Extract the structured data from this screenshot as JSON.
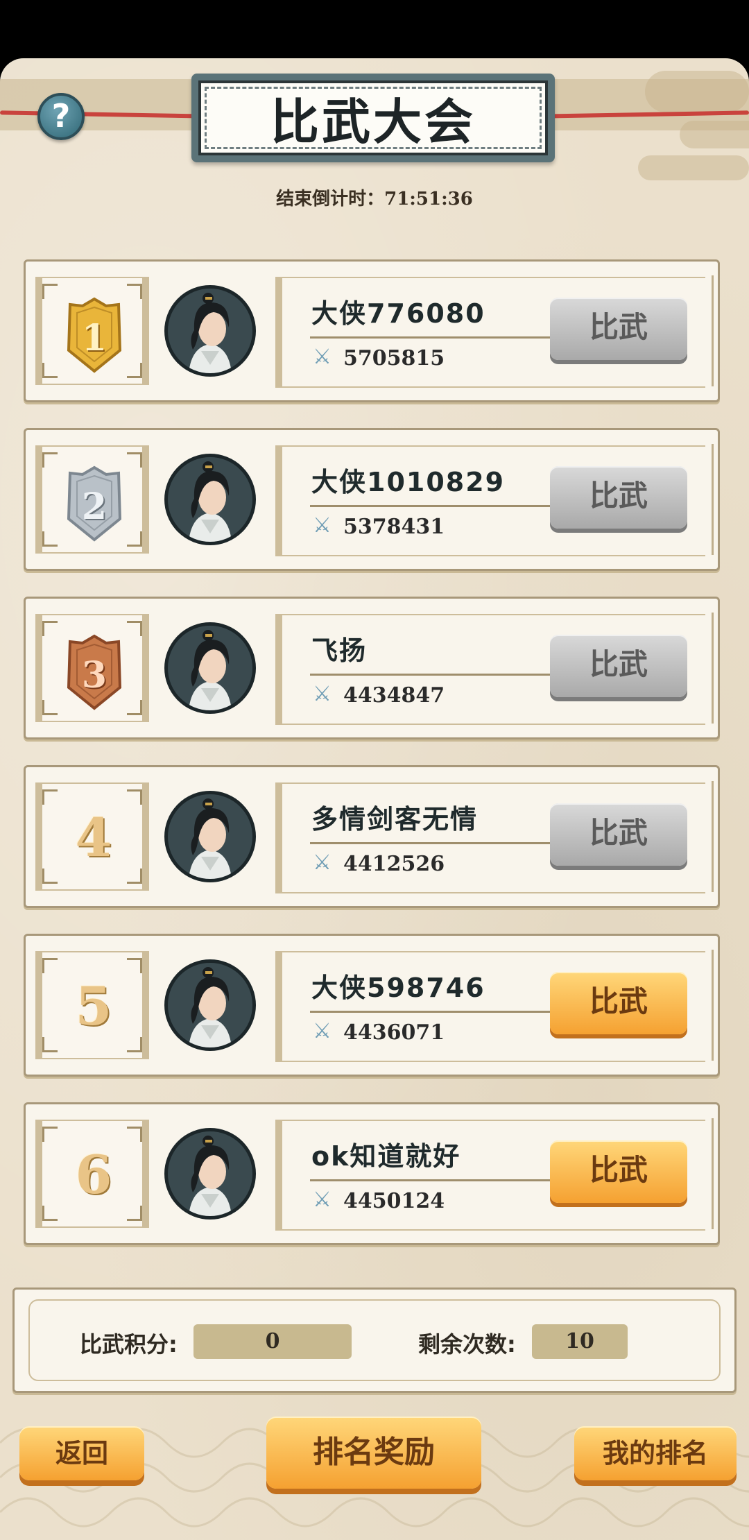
{
  "header": {
    "title": "比武大会",
    "help_icon": "question-mark-icon",
    "countdown_label": "结束倒计时：",
    "countdown_value": "71:51:36"
  },
  "ranks": [
    {
      "rank": "1",
      "medal": "gold",
      "name": "大侠776080",
      "power": "5705815",
      "button": "比武",
      "button_state": "gray"
    },
    {
      "rank": "2",
      "medal": "silver",
      "name": "大侠1010829",
      "power": "5378431",
      "button": "比武",
      "button_state": "gray"
    },
    {
      "rank": "3",
      "medal": "bronze",
      "name": "飞扬",
      "power": "4434847",
      "button": "比武",
      "button_state": "gray"
    },
    {
      "rank": "4",
      "medal": "none",
      "name": "多情剑客无情",
      "power": "4412526",
      "button": "比武",
      "button_state": "gray"
    },
    {
      "rank": "5",
      "medal": "none",
      "name": "大侠598746",
      "power": "4436071",
      "button": "比武",
      "button_state": "orange"
    },
    {
      "rank": "6",
      "medal": "none",
      "name": "ok知道就好",
      "power": "4450124",
      "button": "比武",
      "button_state": "orange"
    }
  ],
  "score": {
    "points_label": "比武积分:",
    "points_value": "0",
    "remaining_label": "剩余次数:",
    "remaining_value": "10"
  },
  "footer": {
    "back": "返回",
    "rewards": "排名奖励",
    "my_rank": "我的排名"
  },
  "colors": {
    "gold": "#e9b53a",
    "silver": "#b9c1c8",
    "bronze": "#c97a4a",
    "button_orange": "#f5a131",
    "button_gray": "#a9a9a9"
  }
}
